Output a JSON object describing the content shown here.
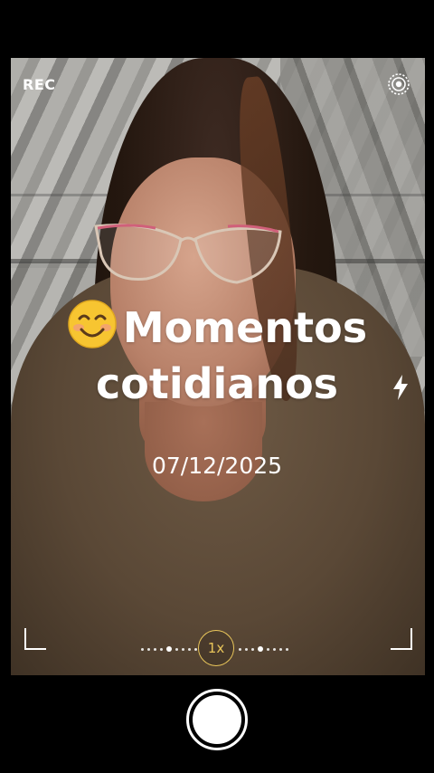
{
  "hud": {
    "rec_label": "REC",
    "settings_icon": "settings-icon",
    "flash_icon": "flash-icon"
  },
  "overlay": {
    "emoji": "smiling-face-emoji",
    "title_line1": "Momentos",
    "title_line2": "cotidianos",
    "date": "07/12/2025"
  },
  "zoom": {
    "level_label": "1x"
  },
  "colors": {
    "accent_zoom": "#e8c55a",
    "background": "#000000"
  }
}
